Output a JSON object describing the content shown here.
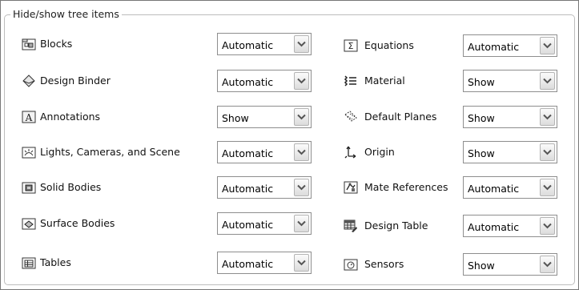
{
  "group": {
    "title": "Hide/show tree items"
  },
  "left_items": [
    {
      "label": "Blocks",
      "value": "Automatic",
      "icon": "blocks-icon"
    },
    {
      "label": "Design Binder",
      "value": "Automatic",
      "icon": "design-binder-icon"
    },
    {
      "label": "Annotations",
      "value": "Show",
      "icon": "annotations-icon"
    },
    {
      "label": "Lights, Cameras, and Scene",
      "value": "Automatic",
      "icon": "lights-cameras-icon"
    },
    {
      "label": "Solid Bodies",
      "value": "Automatic",
      "icon": "solid-bodies-icon"
    },
    {
      "label": "Surface Bodies",
      "value": "Automatic",
      "icon": "surface-bodies-icon"
    },
    {
      "label": "Tables",
      "value": "Automatic",
      "icon": "tables-icon"
    }
  ],
  "right_items": [
    {
      "label": "Equations",
      "value": "Automatic",
      "icon": "equations-icon"
    },
    {
      "label": "Material",
      "value": "Show",
      "icon": "material-icon"
    },
    {
      "label": "Default Planes",
      "value": "Show",
      "icon": "default-planes-icon"
    },
    {
      "label": "Origin",
      "value": "Show",
      "icon": "origin-icon"
    },
    {
      "label": "Mate References",
      "value": "Automatic",
      "icon": "mate-references-icon"
    },
    {
      "label": "Design Table",
      "value": "Automatic",
      "icon": "design-table-icon"
    },
    {
      "label": "Sensors",
      "value": "Show",
      "icon": "sensors-icon"
    }
  ]
}
